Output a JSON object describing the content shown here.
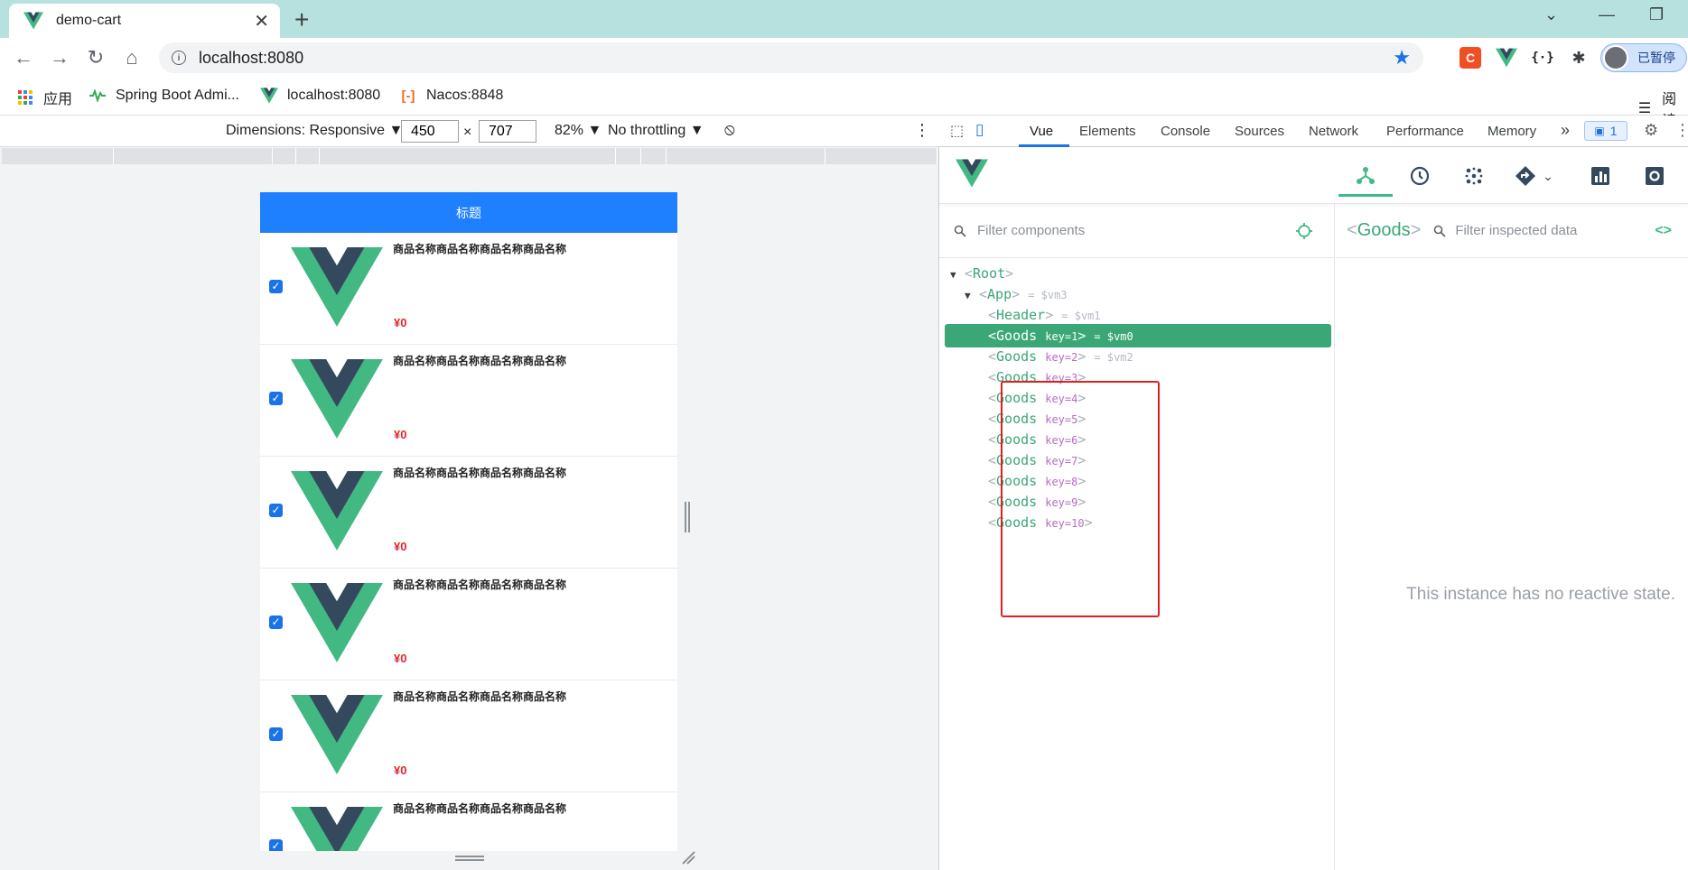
{
  "browser": {
    "tab_title": "demo-cart",
    "new_tab": "+",
    "url": "localhost:8080",
    "profile_label": "已暂停",
    "bookmarks": [
      {
        "label": "应用"
      },
      {
        "label": "Spring Boot Admi..."
      },
      {
        "label": "localhost:8080"
      },
      {
        "label": "Nacos:8848"
      }
    ],
    "reading_list": "阅读"
  },
  "device_toolbar": {
    "dimensions_label": "Dimensions: Responsive ▼",
    "width": "450",
    "height": "707",
    "times": "×",
    "zoom": "82% ▼",
    "throttling": "No throttling ▼"
  },
  "app": {
    "header_title": "标题",
    "goods": [
      {
        "name": "商品名称商品名称商品名称商品名称",
        "price": "¥0",
        "checked": true
      },
      {
        "name": "商品名称商品名称商品名称商品名称",
        "price": "¥0",
        "checked": true
      },
      {
        "name": "商品名称商品名称商品名称商品名称",
        "price": "¥0",
        "checked": true
      },
      {
        "name": "商品名称商品名称商品名称商品名称",
        "price": "¥0",
        "checked": true
      },
      {
        "name": "商品名称商品名称商品名称商品名称",
        "price": "¥0",
        "checked": true
      },
      {
        "name": "商品名称商品名称商品名称商品名称",
        "price": "",
        "checked": true
      }
    ]
  },
  "devtools": {
    "tabs": [
      "Vue",
      "Elements",
      "Console",
      "Sources",
      "Network",
      "Performance",
      "Memory"
    ],
    "more_tabs": "»",
    "issues_badge": "1",
    "vue": {
      "filter_placeholder": "Filter components",
      "tree": [
        {
          "lt": "<",
          "name": "Root",
          "key": "",
          "gt": ">",
          "vm": "",
          "expanded": true
        },
        {
          "lt": "<",
          "name": "App",
          "key": "",
          "gt": ">",
          "vm": "= $vm3",
          "expanded": true
        },
        {
          "lt": "<",
          "name": "Header",
          "key": "",
          "gt": ">",
          "vm": "= $vm1"
        },
        {
          "lt": "<",
          "name": "Goods",
          "key": "key=1",
          "gt": ">",
          "vm": "= $vm0",
          "selected": true
        },
        {
          "lt": "<",
          "name": "Goods",
          "key": "key=2",
          "gt": ">",
          "vm": "= $vm2"
        },
        {
          "lt": "<",
          "name": "Goods",
          "key": "key=3",
          "gt": ">",
          "vm": ""
        },
        {
          "lt": "<",
          "name": "Goods",
          "key": "key=4",
          "gt": ">",
          "vm": ""
        },
        {
          "lt": "<",
          "name": "Goods",
          "key": "key=5",
          "gt": ">",
          "vm": ""
        },
        {
          "lt": "<",
          "name": "Goods",
          "key": "key=6",
          "gt": ">",
          "vm": ""
        },
        {
          "lt": "<",
          "name": "Goods",
          "key": "key=7",
          "gt": ">",
          "vm": ""
        },
        {
          "lt": "<",
          "name": "Goods",
          "key": "key=8",
          "gt": ">",
          "vm": ""
        },
        {
          "lt": "<",
          "name": "Goods",
          "key": "key=9",
          "gt": ">",
          "vm": ""
        },
        {
          "lt": "<",
          "name": "Goods",
          "key": "key=10",
          "gt": ">",
          "vm": ""
        }
      ],
      "inspected": {
        "lt": "<",
        "name": "Goods",
        "gt": ">"
      },
      "inspect_filter_placeholder": "Filter inspected data",
      "code_btn": "<>",
      "empty_state": "This instance has no reactive state."
    }
  },
  "colors": {
    "vue_green": "#42b883",
    "vue_dark": "#35495e",
    "app_header": "#1e80ff",
    "price": "#e0252b",
    "highlight_box": "#e02020",
    "tab_strip": "#b7e1de"
  }
}
